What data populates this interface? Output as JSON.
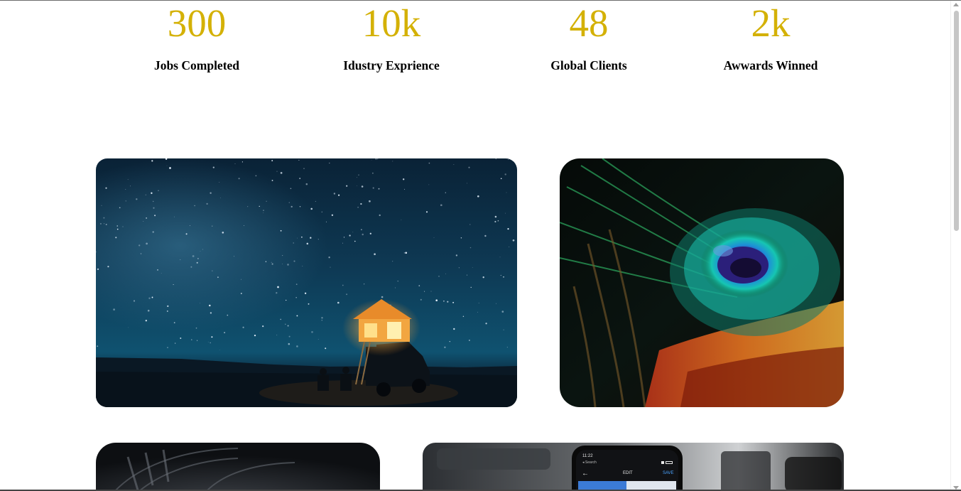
{
  "theme": {
    "accent": "#d4b106"
  },
  "stats": [
    {
      "number": "300",
      "label": "Jobs Completed"
    },
    {
      "number": "10k",
      "label": "Idustry Exprience"
    },
    {
      "number": "48",
      "label": "Global Clients"
    },
    {
      "number": "2k",
      "label": "Awwards Winned"
    }
  ],
  "gallery": {
    "images": [
      {
        "name": "starry-night-camper-image"
      },
      {
        "name": "peacock-feather-image"
      },
      {
        "name": "dark-tunnel-image"
      },
      {
        "name": "phone-edit-screen-image"
      }
    ],
    "phone_screen": {
      "time": "11:22",
      "back_label": "◂ Search",
      "title": "EDIT",
      "action": "SAVE"
    }
  }
}
